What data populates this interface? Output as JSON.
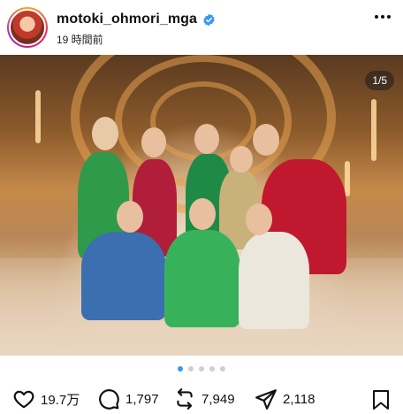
{
  "post": {
    "username": "motoki_ohmori_mga",
    "timestamp": "19 時間前",
    "carousel_counter": "1/5",
    "carousel_total": 5,
    "carousel_current": 1
  },
  "actions": {
    "likes": "19.7万",
    "comments": "1,797",
    "reposts": "7,949",
    "shares": "2,118"
  },
  "icons": {
    "like": "heart-icon",
    "comment": "comment-icon",
    "repost": "repost-icon",
    "share": "send-icon",
    "save": "bookmark-icon",
    "more": "more-icon",
    "verified": "verified-badge-icon"
  },
  "colors": {
    "verified": "#3897f0",
    "active_dot": "#3897f0"
  }
}
